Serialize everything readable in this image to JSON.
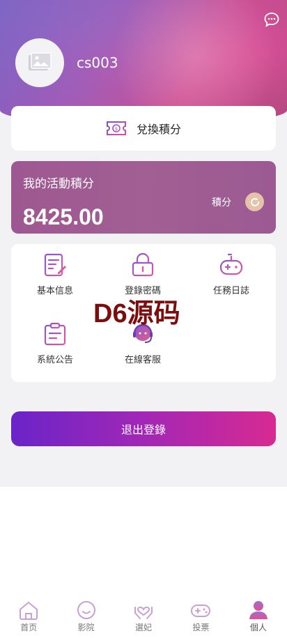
{
  "profile": {
    "username": "cs003"
  },
  "exchange": {
    "label": "兌換積分"
  },
  "points": {
    "title": "我的活動積分",
    "value": "8425.00",
    "unit": "積分"
  },
  "menu": {
    "items": [
      {
        "label": "基本信息",
        "icon": "edit-document-icon"
      },
      {
        "label": "登錄密碼",
        "icon": "lock-icon"
      },
      {
        "label": "任務日誌",
        "icon": "gamepad-icon"
      },
      {
        "label": "系統公告",
        "icon": "clipboard-icon"
      },
      {
        "label": "在線客服",
        "icon": "headset-icon"
      }
    ]
  },
  "watermark": "D6源码",
  "logout": {
    "label": "退出登錄"
  },
  "tabbar": {
    "items": [
      {
        "label": "首页",
        "icon": "home-icon"
      },
      {
        "label": "影院",
        "icon": "smile-icon"
      },
      {
        "label": "選妃",
        "icon": "heart-hands-icon"
      },
      {
        "label": "投票",
        "icon": "gamepad-icon"
      },
      {
        "label": "個人",
        "icon": "person-icon",
        "active": true
      }
    ]
  },
  "colors": {
    "accent": "#c0569a",
    "points_card": "#9e5891",
    "logout_start": "#6a24c8",
    "logout_end": "#d72a91",
    "refresh_badge": "#e5c2a8"
  }
}
